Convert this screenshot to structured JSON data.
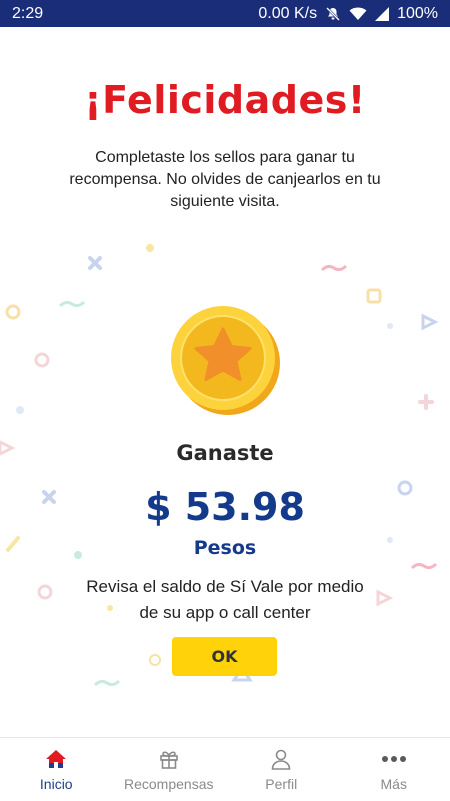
{
  "status_bar": {
    "time": "2:29",
    "network_speed": "0.00 K/s",
    "battery": "100%",
    "icons": [
      "mute-icon",
      "wifi-icon",
      "signal-icon"
    ]
  },
  "reward": {
    "title": "¡Felicidades!",
    "message": "Completaste los sellos para ganar tu recompensa. No olvides de canjearlos en tu siguiente visita.",
    "won_label": "Ganaste",
    "amount": "$ 53.98",
    "currency": "Pesos",
    "note": "Revisa el saldo de Sí Vale por medio de su app o call center",
    "ok_label": "OK",
    "coin_icon": "star-coin-icon"
  },
  "bottom_nav": {
    "items": [
      {
        "label": "Inicio",
        "icon": "home-icon",
        "active": true
      },
      {
        "label": "Recompensas",
        "icon": "gift-icon",
        "active": false
      },
      {
        "label": "Perfil",
        "icon": "user-icon",
        "active": false
      },
      {
        "label": "Más",
        "icon": "more-icon",
        "active": false
      }
    ]
  },
  "colors": {
    "status_bar": "#1a2d78",
    "title": "#e01b22",
    "amount": "#143a8c",
    "button": "#ffd20a",
    "nav_active": "#1f3f8c"
  }
}
